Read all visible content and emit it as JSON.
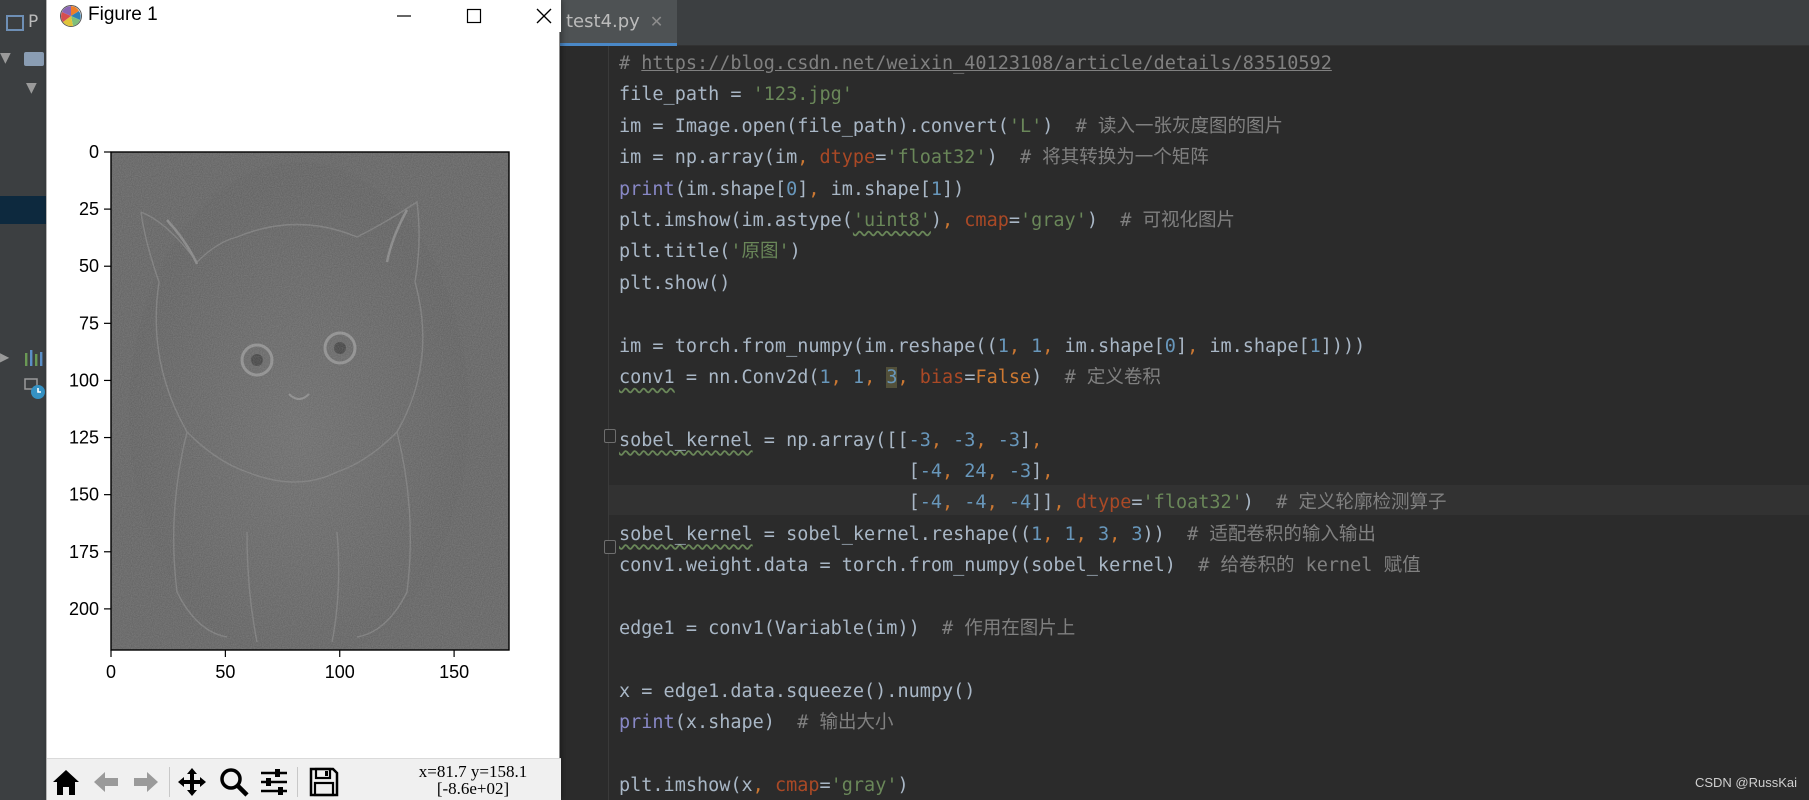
{
  "ide": {
    "title_fragment": "P",
    "active_tab": {
      "label": "test4.py",
      "close_icon": "close-icon"
    },
    "code_lines": [
      [
        [
          "cm",
          "# "
        ],
        [
          "url",
          "https://blog.csdn.net/weixin_40123108/article/details/83510592"
        ]
      ],
      [
        [
          "pl",
          "file_path = "
        ],
        [
          "str",
          "'123.jpg'"
        ]
      ],
      [
        [
          "pl",
          "im = Image.open(file_path).convert("
        ],
        [
          "str",
          "'L'"
        ],
        [
          "pl",
          ")  "
        ],
        [
          "cm",
          "# 读入一张灰度图的图片"
        ]
      ],
      [
        [
          "pl",
          "im = np.array(im"
        ],
        [
          "kw",
          ", "
        ],
        [
          "prm",
          "dtype"
        ],
        [
          "pl",
          "="
        ],
        [
          "str",
          "'float32'"
        ],
        [
          "pl",
          ")  "
        ],
        [
          "cm",
          "# 将其转换为一个矩阵"
        ]
      ],
      [
        [
          "bi",
          "print"
        ],
        [
          "pl",
          "(im.shape["
        ],
        [
          "num",
          "0"
        ],
        [
          "pl",
          "]"
        ],
        [
          "kw",
          ", "
        ],
        [
          "pl",
          "im.shape["
        ],
        [
          "num",
          "1"
        ],
        [
          "pl",
          "])"
        ]
      ],
      [
        [
          "pl",
          "plt.imshow(im.astype("
        ],
        [
          "strw",
          "'uint8'"
        ],
        [
          "pl",
          ")"
        ],
        [
          "kw",
          ", "
        ],
        [
          "prm",
          "cmap"
        ],
        [
          "pl",
          "="
        ],
        [
          "str",
          "'gray'"
        ],
        [
          "pl",
          ")  "
        ],
        [
          "cm",
          "# 可视化图片"
        ]
      ],
      [
        [
          "pl",
          "plt.title("
        ],
        [
          "str",
          "'原图'"
        ],
        [
          "pl",
          ")"
        ]
      ],
      [
        [
          "pl",
          "plt.show()"
        ]
      ],
      [
        [
          "pl",
          ""
        ]
      ],
      [
        [
          "pl",
          "im = torch.from_numpy(im.reshape(("
        ],
        [
          "num",
          "1"
        ],
        [
          "kw",
          ", "
        ],
        [
          "num",
          "1"
        ],
        [
          "kw",
          ", "
        ],
        [
          "pl",
          "im.shape["
        ],
        [
          "num",
          "0"
        ],
        [
          "pl",
          "]"
        ],
        [
          "kw",
          ", "
        ],
        [
          "pl",
          "im.shape["
        ],
        [
          "num",
          "1"
        ],
        [
          "pl",
          "])))"
        ]
      ],
      [
        [
          "plw",
          "conv1"
        ],
        [
          "pl",
          " = nn.Conv2d("
        ],
        [
          "num",
          "1"
        ],
        [
          "kw",
          ", "
        ],
        [
          "num",
          "1"
        ],
        [
          "kw",
          ", "
        ],
        [
          "numh",
          "3"
        ],
        [
          "kw",
          ", "
        ],
        [
          "prm",
          "bias"
        ],
        [
          "pl",
          "="
        ],
        [
          "kw",
          "False"
        ],
        [
          "pl",
          ")  "
        ],
        [
          "cm",
          "# 定义卷积"
        ]
      ],
      [
        [
          "pl",
          ""
        ]
      ],
      [
        [
          "plw",
          "sobel_kernel"
        ],
        [
          "pl",
          " = np.array([["
        ],
        [
          "num",
          "-3"
        ],
        [
          "kw",
          ", "
        ],
        [
          "num",
          "-3"
        ],
        [
          "kw",
          ", "
        ],
        [
          "num",
          "-3"
        ],
        [
          "pl",
          "]"
        ],
        [
          "kw",
          ","
        ]
      ],
      [
        [
          "pl",
          "                          ["
        ],
        [
          "num",
          "-4"
        ],
        [
          "kw",
          ", "
        ],
        [
          "num",
          "24"
        ],
        [
          "kw",
          ", "
        ],
        [
          "num",
          "-3"
        ],
        [
          "pl",
          "]"
        ],
        [
          "kw",
          ","
        ]
      ],
      [
        [
          "pl",
          "                          ["
        ],
        [
          "num",
          "-4"
        ],
        [
          "kw",
          ", "
        ],
        [
          "num",
          "-4"
        ],
        [
          "kw",
          ", "
        ],
        [
          "num",
          "-4"
        ],
        [
          "pl",
          "]]"
        ],
        [
          "kw",
          ", "
        ],
        [
          "prm",
          "dtype"
        ],
        [
          "pl",
          "="
        ],
        [
          "str",
          "'float32'"
        ],
        [
          "pl",
          ")  "
        ],
        [
          "cm",
          "# 定义轮廓检测算子"
        ]
      ],
      [
        [
          "plw",
          "sobel_kernel"
        ],
        [
          "pl",
          " = sobel_kernel.reshape(("
        ],
        [
          "num",
          "1"
        ],
        [
          "kw",
          ", "
        ],
        [
          "num",
          "1"
        ],
        [
          "kw",
          ", "
        ],
        [
          "num",
          "3"
        ],
        [
          "kw",
          ", "
        ],
        [
          "num",
          "3"
        ],
        [
          "pl",
          "))  "
        ],
        [
          "cm",
          "# 适配卷积的输入输出"
        ]
      ],
      [
        [
          "pl",
          "conv1.weight.data = torch.from_numpy(sobel_kernel)  "
        ],
        [
          "cm",
          "# 给卷积的 kernel 赋值"
        ]
      ],
      [
        [
          "pl",
          ""
        ]
      ],
      [
        [
          "pl",
          "edge1 = conv1(Variable(im))  "
        ],
        [
          "cm",
          "# 作用在图片上"
        ]
      ],
      [
        [
          "pl",
          ""
        ]
      ],
      [
        [
          "pl",
          "x = edge1.data.squeeze().numpy()"
        ]
      ],
      [
        [
          "bi",
          "print"
        ],
        [
          "pl",
          "(x.shape)  "
        ],
        [
          "cm",
          "# 输出大小"
        ]
      ],
      [
        [
          "pl",
          ""
        ]
      ],
      [
        [
          "pl",
          "plt.imshow(x"
        ],
        [
          "kw",
          ", "
        ],
        [
          "prm",
          "cmap"
        ],
        [
          "pl",
          "="
        ],
        [
          "str",
          "'gray'"
        ],
        [
          "pl",
          ")"
        ]
      ]
    ],
    "watermark": "CSDN @RussKai"
  },
  "figure": {
    "window_title": "Figure 1",
    "status": {
      "xy": "x=81.7 y=158.1",
      "value": "[-8.6e+02]"
    },
    "toolbar_icons": [
      "home-icon",
      "back-icon",
      "forward-icon",
      "pan-icon",
      "zoom-icon",
      "subplots-icon",
      "save-icon"
    ]
  },
  "chart_data": {
    "type": "image",
    "title": "",
    "cmap": "gray",
    "xlim": [
      0,
      174
    ],
    "ylim": [
      218,
      0
    ],
    "xticks": [
      0,
      50,
      100,
      150
    ],
    "yticks": [
      0,
      25,
      50,
      75,
      100,
      125,
      150,
      175,
      200
    ],
    "xlabel": "",
    "ylabel": ""
  }
}
